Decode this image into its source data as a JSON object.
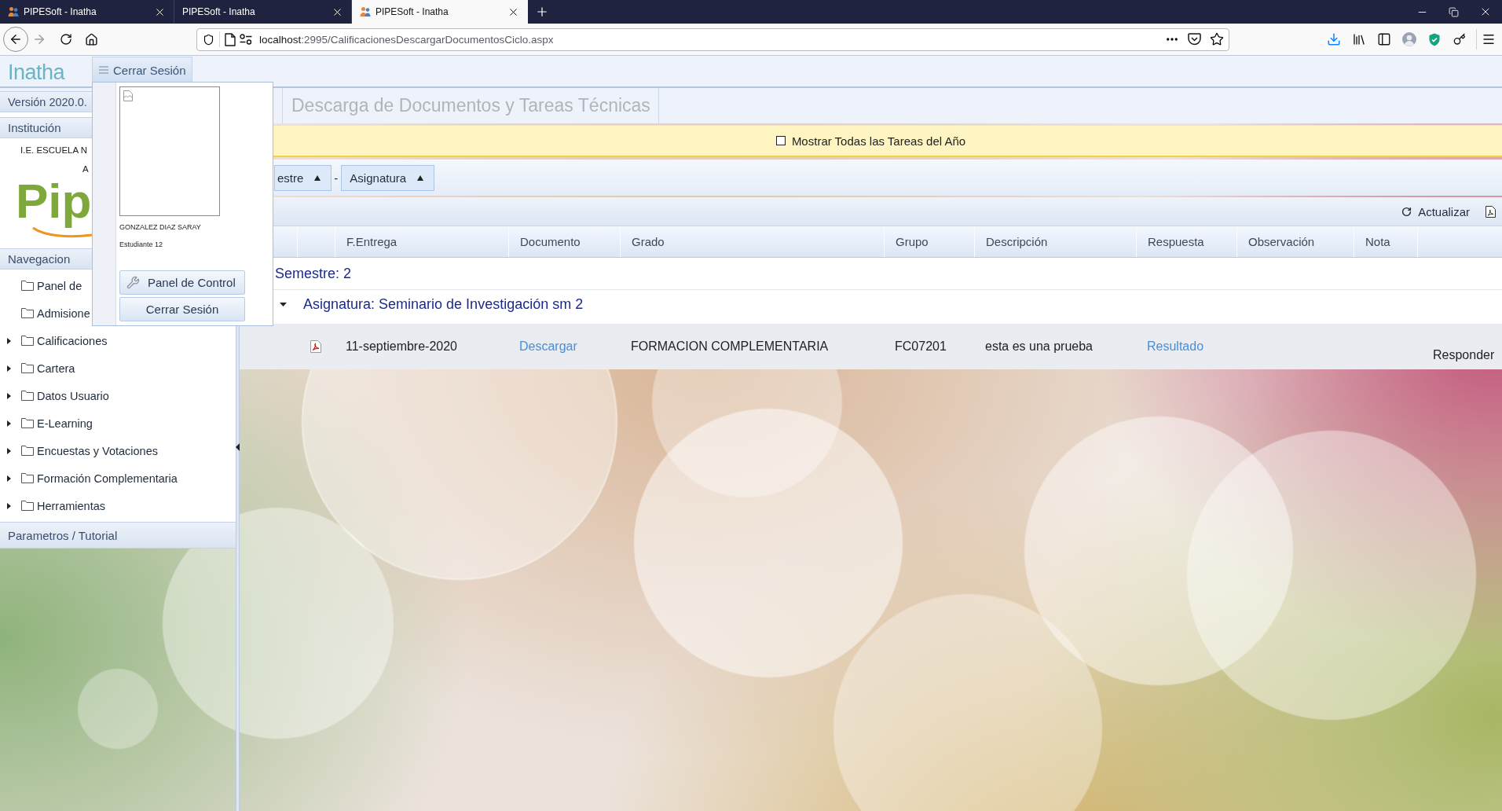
{
  "browser": {
    "tabs": [
      {
        "title": "PIPESoft - Inatha",
        "icon": true,
        "selected": false
      },
      {
        "title": "PIPESoft - Inatha",
        "icon": false,
        "selected": false
      },
      {
        "title": "PIPESoft - Inatha",
        "icon": true,
        "selected": true
      }
    ],
    "url": {
      "host": "localhost",
      "path": ":2995/CalificacionesDescargarDocumentosCiclo.aspx"
    }
  },
  "header": {
    "logo": "Inatha",
    "menu_button": "Cerrar Sesión"
  },
  "user_menu": {
    "name": "GONZALEZ DIAZ SARAY",
    "role": "Estudiante 12",
    "buttons": [
      {
        "label": "Panel de Control",
        "kind": "icon"
      },
      {
        "label": "Cerrar Sesión",
        "kind": "plain"
      }
    ]
  },
  "sidebar": {
    "version": "Versión 2020.0.",
    "institution": {
      "title": "Institución",
      "lines": [
        "I.E. ESCUELA N",
        "A"
      ],
      "logo": "Pip"
    },
    "navigation": {
      "title": "Navegacion",
      "items": [
        {
          "label": "Panel de",
          "expandable": false
        },
        {
          "label": "Admisione",
          "expandable": false
        },
        {
          "label": "Calificaciones",
          "expandable": true
        },
        {
          "label": "Cartera",
          "expandable": true
        },
        {
          "label": "Datos Usuario",
          "expandable": true
        },
        {
          "label": "E-Learning",
          "expandable": true
        },
        {
          "label": "Encuestas y Votaciones",
          "expandable": true
        },
        {
          "label": "Formación Complementaria",
          "expandable": true
        },
        {
          "label": "Herramientas",
          "expandable": true
        }
      ]
    },
    "footer": "Parametros / Tutorial"
  },
  "page_title": "Descarga de Documentos y Tareas Técnicas",
  "show_all": {
    "label": "Mostrar Todas las Tareas del Año",
    "checked": false
  },
  "grouping": {
    "groups": [
      "estre",
      "Asignatura"
    ],
    "separator": "-"
  },
  "toolbar": {
    "refresh": "Actualizar"
  },
  "table": {
    "columns": [
      "F.Entrega",
      "Documento",
      "Grado",
      "Grupo",
      "Descripción",
      "Respuesta",
      "Observación",
      "Nota"
    ],
    "groups": [
      {
        "label": "Semestre: 2",
        "children": [
          {
            "label": "Asignatura: Seminario de Investigación sm 2",
            "expanded": true,
            "rows": [
              {
                "date": "11-septiembre-2020",
                "document": "Descargar",
                "grade": "FORMACION COMPLEMENTARIA",
                "group": "FC07201",
                "description": "esta es una prueba",
                "answer": "Resultado",
                "action": "Responder"
              }
            ]
          }
        ]
      }
    ]
  }
}
